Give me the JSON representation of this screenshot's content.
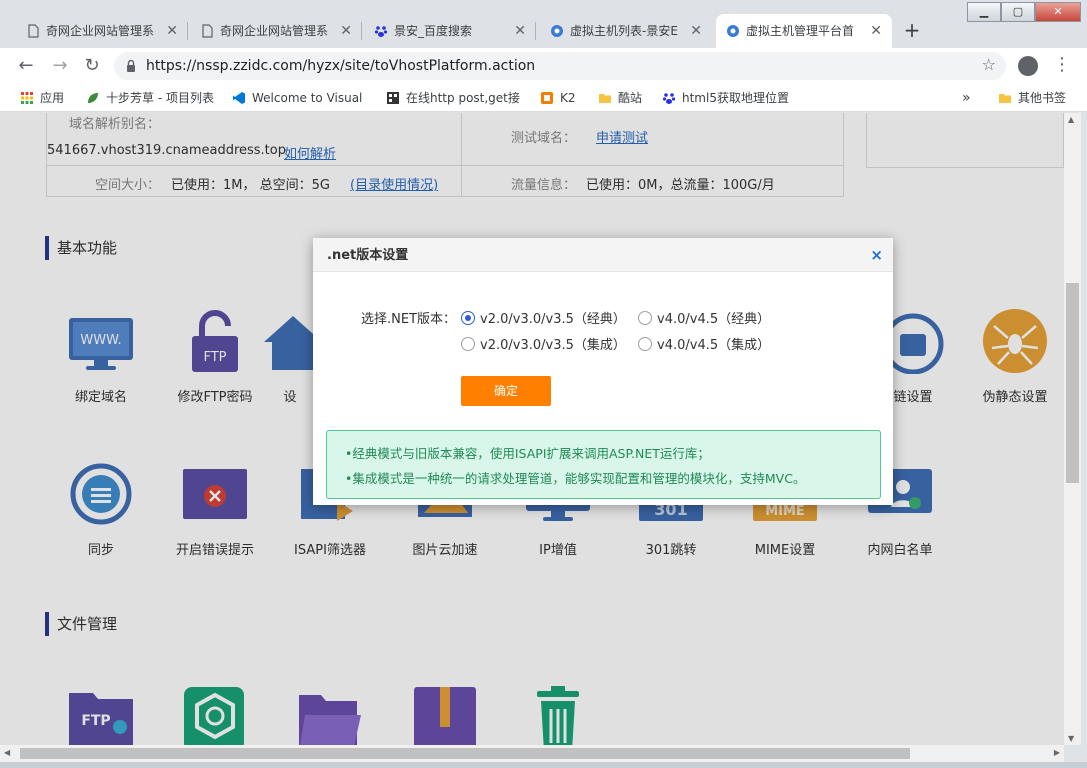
{
  "browser": {
    "tabs": [
      {
        "title": "奇网企业网站管理系",
        "icon": "page-icon",
        "active": false
      },
      {
        "title": "奇网企业网站管理系",
        "icon": "page-icon",
        "active": false
      },
      {
        "title": "景安_百度搜索",
        "icon": "baidu-paw-icon",
        "active": false
      },
      {
        "title": "虚拟主机列表-景安E",
        "icon": "zzidc-icon",
        "active": false
      },
      {
        "title": "虚拟主机管理平台首",
        "icon": "zzidc-icon",
        "active": true
      }
    ],
    "tab_close": "✕",
    "new_tab": "+",
    "url": "https://nssp.zzidc.com/hyzx/site/toVhostPlatform.action",
    "bookmarks": [
      {
        "label": "应用",
        "icon": "apps-grid-icon"
      },
      {
        "label": "十步芳草 - 项目列表",
        "icon": "leaf-icon"
      },
      {
        "label": "Welcome to Visual",
        "icon": "vs-icon"
      },
      {
        "label": "在线http post,get接",
        "icon": "qr-icon"
      },
      {
        "label": "K2",
        "icon": "k2-icon"
      },
      {
        "label": "酷站",
        "icon": "folder-icon"
      },
      {
        "label": "html5获取地理位置",
        "icon": "baidu-paw-icon"
      },
      {
        "label": "其他书签",
        "icon": "folder-icon"
      }
    ],
    "more_bookmarks": "»"
  },
  "info": {
    "alias_label": "域名解析别名：",
    "alias_value": "541667.vhost319.cnameaddress.top",
    "alias_link": "如何解析",
    "test_label": "测试域名：",
    "test_link": "申请测试",
    "space_label": "空间大小：",
    "space_value": "已使用：1M，  总空间：5G",
    "space_link": "(目录使用情况)",
    "traffic_label": "流量信息：",
    "traffic_value": "已使用：0M，总流量：100G/月"
  },
  "sections": {
    "basic": "基本功能",
    "files": "文件管理"
  },
  "features_row1": [
    {
      "label": "绑定域名",
      "icon": "www-monitor-icon"
    },
    {
      "label": "修改FTP密码",
      "icon": "ftp-lock-icon"
    },
    {
      "label": "设",
      "icon": "home-icon"
    },
    {
      "label": "链设置",
      "icon": "chain-lock-icon"
    },
    {
      "label": "伪静态设置",
      "icon": "spider-icon"
    }
  ],
  "features_row2": [
    {
      "label": "同步",
      "icon": "sync-icon"
    },
    {
      "label": "开启错误提示",
      "icon": "error-window-icon"
    },
    {
      "label": "ISAPI筛选器",
      "icon": "isapi-icon"
    },
    {
      "label": "图片云加速",
      "icon": "image-cloud-icon"
    },
    {
      "label": "IP增值",
      "icon": "ip-monitor-icon"
    },
    {
      "label": "301跳转",
      "icon": "redirect-301-icon"
    },
    {
      "label": "MIME设置",
      "icon": "mime-icon"
    },
    {
      "label": "内网白名单",
      "icon": "whitelist-icon"
    }
  ],
  "file_icons": [
    "ftp-folder-icon",
    "package-icon",
    "open-folder-icon",
    "zip-icon",
    "trash-icon"
  ],
  "row2_partial": {
    "redirect_code": "301",
    "mime_code": "MIME"
  },
  "ftp_badge": "FTP",
  "www_badge": "WWW.",
  "modal": {
    "title": ".net版本设置",
    "close": "×",
    "select_label": "选择.NET版本：",
    "options": [
      {
        "label": "v2.0/v3.0/v3.5（经典）",
        "checked": true
      },
      {
        "label": "v4.0/v4.5（经典）",
        "checked": false
      },
      {
        "label": "v2.0/v3.0/v3.5（集成）",
        "checked": false
      },
      {
        "label": "v4.0/v4.5（集成）",
        "checked": false
      }
    ],
    "confirm": "确定",
    "notes": [
      "•经典模式与旧版本兼容，使用ISAPI扩展来调用ASP.NET运行库；",
      "•集成模式是一种统一的请求处理管道，能够实现配置和管理的模块化，支持MVC。"
    ]
  },
  "colors": {
    "accent_orange": "#ff7f00",
    "link_blue": "#2b6cc4",
    "notice_green": "#228a55",
    "icon_blue": "#3f6fb5",
    "icon_purple": "#5b4fa6"
  }
}
